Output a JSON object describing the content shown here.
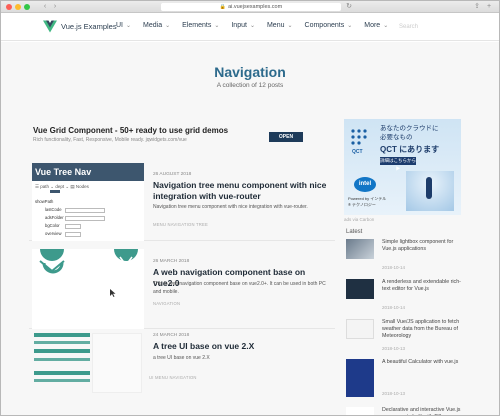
{
  "browser": {
    "url": "ai.vuejsexamples.com"
  },
  "nav": {
    "brand": "Vue.js Examples",
    "items": [
      {
        "label": "UI",
        "caret": "⌄"
      },
      {
        "label": "Media",
        "caret": "⌄"
      },
      {
        "label": "Elements",
        "caret": "⌄"
      },
      {
        "label": "Input",
        "caret": "⌄"
      },
      {
        "label": "Menu",
        "caret": "⌄"
      },
      {
        "label": "Components",
        "caret": "⌄"
      },
      {
        "label": "More",
        "caret": "⌄"
      }
    ],
    "search_placeholder": "Search"
  },
  "hero": {
    "title": "Navigation",
    "subtitle": "A collection of 12 posts"
  },
  "ad_banner": {
    "title": "Vue Grid Component - 50+ ready to use grid demos",
    "desc1": "Rich functionality, Fast, Responsive, Mobile ready.",
    "desc2": "jqwidgets.com/vue",
    "button": "OPEN"
  },
  "sidebar_ad": {
    "line1": "あなたのクラウドに",
    "line2": "必要なもの",
    "line3": "QCT にあります",
    "button": "詳細はこちらから ▶",
    "logo_text": "QCT",
    "intel": "intel",
    "intel_caption": "Powered by インテル® テクノロジー",
    "caption": "ads via Carbon"
  },
  "latest": {
    "heading": "Latest",
    "items": [
      {
        "text": "Simple lightbox component for Vue.js applications",
        "date": "2018-10-14"
      },
      {
        "text": "A renderless and extendable rich-text editor for Vue.js",
        "date": "2018-10-14"
      },
      {
        "text": "Small Vue/JS application to fetch weather data from the Bureau of Meteorology",
        "date": "2018-10-13"
      },
      {
        "text": "A beautiful Calculator with vue.js",
        "date": "2018-10-13"
      },
      {
        "text": "Declarative and interactive Vue.js components built with D3",
        "date": ""
      }
    ]
  },
  "posts": [
    {
      "date": "26 AUGUST 2018",
      "title": "Navigation tree menu component with nice integration with vue-router",
      "desc": "Navigation tree menu component with nice integration with vue-router.",
      "tags": "MENU   NAVIGATION   TREE",
      "thumb_heading": "Vue Tree Nav",
      "thumb_fields": [
        "showPath",
        "lastCode",
        "adsFolder",
        "bgColor",
        "overview"
      ]
    },
    {
      "date": "26 MARCH 2018",
      "title": "A web navigation component base on vue2.0",
      "desc": "This is web navigation component base on vue2.0+. It can be used in both PC and mobile.",
      "tags": "NAVIGATION"
    },
    {
      "date": "24 MARCH 2018",
      "title": "A tree UI base on vue 2.X",
      "desc": "a tree UI base on vue 2.X",
      "tags": "UI   MENU   NAVIGATION"
    }
  ],
  "colors": {
    "hero_title": "#2c6a8c",
    "vue_green": "#41b883",
    "vue_dark": "#35495e",
    "teal": "#3d9a8c"
  }
}
